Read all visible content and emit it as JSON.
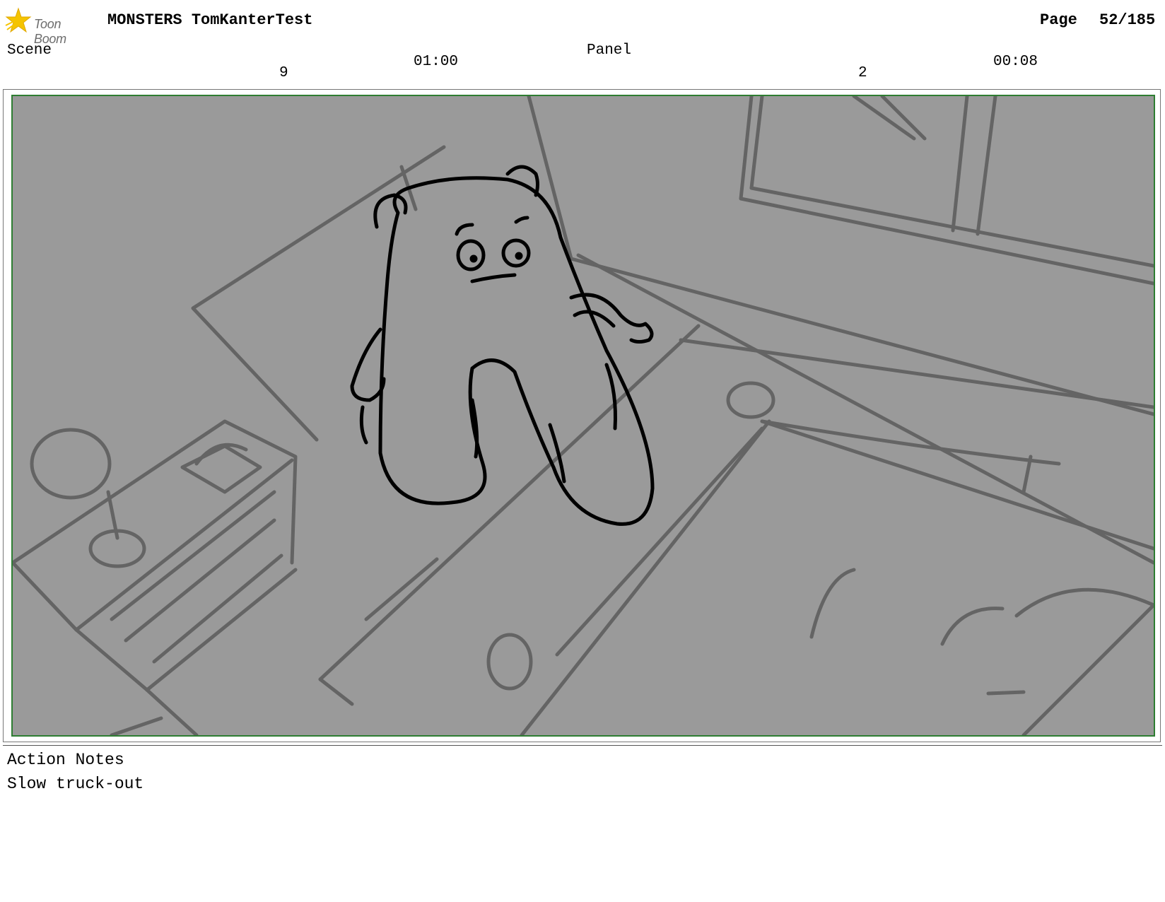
{
  "header": {
    "logo_text": "Toon Boom",
    "project_title": "MONSTERS TomKanterTest",
    "page_label": "Page",
    "page_number": "52/185"
  },
  "scene": {
    "label": "Scene",
    "number": "9",
    "duration": "01:00"
  },
  "panel": {
    "label": "Panel",
    "number": "2",
    "duration": "00:08"
  },
  "notes": {
    "heading": "Action Notes",
    "text": "Slow truck-out"
  },
  "colors": {
    "frame_border": "#2e7d32",
    "panel_fill": "#9a9a9a",
    "sketch_background": "#646464",
    "sketch_character": "#000000",
    "logo_star": "#f5c400"
  }
}
